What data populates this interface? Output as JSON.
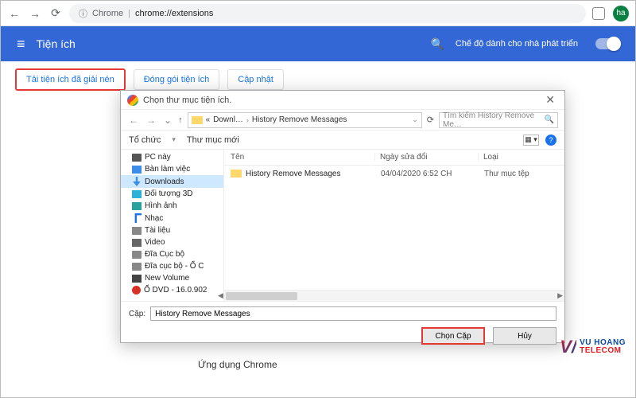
{
  "browser": {
    "app": "Chrome",
    "url": "chrome://extensions",
    "avatar": "ha"
  },
  "header": {
    "title": "Tiện ích",
    "dev_mode": "Chế độ dành cho nhà phát triển"
  },
  "toolbar": {
    "load_unpacked": "Tải tiện ích đã giải nén",
    "pack": "Đóng gói tiện ích",
    "update": "Cập nhật"
  },
  "dialog": {
    "title": "Chọn thư mục tiện ích.",
    "breadcrumb": {
      "root": "Downl…",
      "folder": "History Remove Messages"
    },
    "search_placeholder": "Tìm kiếm History Remove Me…",
    "organize": "Tổ chức",
    "new_folder": "Thư mục mới",
    "columns": {
      "name": "Tên",
      "modified": "Ngày sửa đổi",
      "type": "Loại"
    },
    "tree": [
      {
        "label": "PC này",
        "icon": "pc"
      },
      {
        "label": "Bàn làm việc",
        "icon": "desk"
      },
      {
        "label": "Downloads",
        "icon": "dl",
        "selected": true
      },
      {
        "label": "Đối tượng 3D",
        "icon": "obj3d"
      },
      {
        "label": "Hình ảnh",
        "icon": "img"
      },
      {
        "label": "Nhạc",
        "icon": "mus"
      },
      {
        "label": "Tài liệu",
        "icon": "doc"
      },
      {
        "label": "Video",
        "icon": "vid"
      },
      {
        "label": "Đĩa Cục bộ",
        "icon": "hd"
      },
      {
        "label": "Đĩa cục bộ - Ổ C",
        "icon": "hd"
      },
      {
        "label": "New Volume",
        "icon": "nv"
      },
      {
        "label": "Ổ DVD - 16.0.902",
        "icon": "dvd"
      }
    ],
    "files": [
      {
        "name": "History Remove Messages",
        "modified": "04/04/2020 6:52 CH",
        "type": "Thư mục tệp"
      }
    ],
    "folder_label": "Cặp:",
    "folder_value": "History Remove Messages",
    "select": "Chọn Cặp",
    "cancel": "Hủy"
  },
  "peek_text": "Ứng dụng Chrome",
  "logo": {
    "brand1": "VU HOANG",
    "brand2": "TELECOM"
  }
}
